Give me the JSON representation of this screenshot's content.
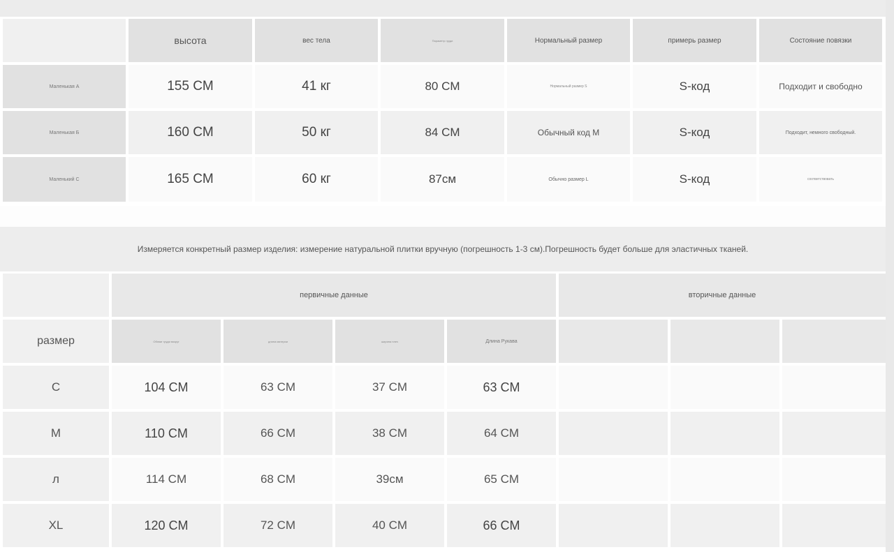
{
  "size_table": {
    "headers": [
      "",
      "высота",
      "вес тела",
      "Параметр груди",
      "Нормальный размер",
      "примерь размер",
      "Состояние повязки"
    ],
    "rows": [
      {
        "label": "Маленькая A",
        "height": "155 CM",
        "weight": "41 кг",
        "chest": "80 CM",
        "normal_size": "Нормальный размер S",
        "try_size": "S-код",
        "state": "Подходит и свободно"
      },
      {
        "label": "Маленькая Б",
        "height": "160 CM",
        "weight": "50 кг",
        "chest": "84 CM",
        "normal_size": "Обычный код M",
        "try_size": "S-код",
        "state": "Подходит, немного свободный."
      },
      {
        "label": "Маленький C",
        "height": "165 CM",
        "weight": "60 кг",
        "chest": "87см",
        "normal_size": "Обычно размер L",
        "try_size": "S-код",
        "state": "соответствовать"
      }
    ]
  },
  "note": "Измеряется конкретный размер изделия: измерение натуральной плитки вручную (погрешность 1-3 см).Погрешность будет больше для эластичных тканей.",
  "measure_table": {
    "primary_label": "первичные данные",
    "secondary_label": "вторичные данные",
    "size_label": "размер",
    "columns": [
      "Обхват груди вокруг",
      "длина материи",
      "ширина плеч",
      "Длина Рукава"
    ],
    "rows": [
      {
        "size": "C",
        "values": [
          "104 CM",
          "63 CM",
          "37 CM",
          "63 CM"
        ]
      },
      {
        "size": "M",
        "values": [
          "110 CM",
          "66 CM",
          "38 CM",
          "64 CM"
        ]
      },
      {
        "size": "л",
        "values": [
          "114 CM",
          "68 CM",
          "39см",
          "65 CM"
        ]
      },
      {
        "size": "XL",
        "values": [
          "120 CM",
          "72 CM",
          "40 CM",
          "66 CM"
        ]
      }
    ]
  }
}
